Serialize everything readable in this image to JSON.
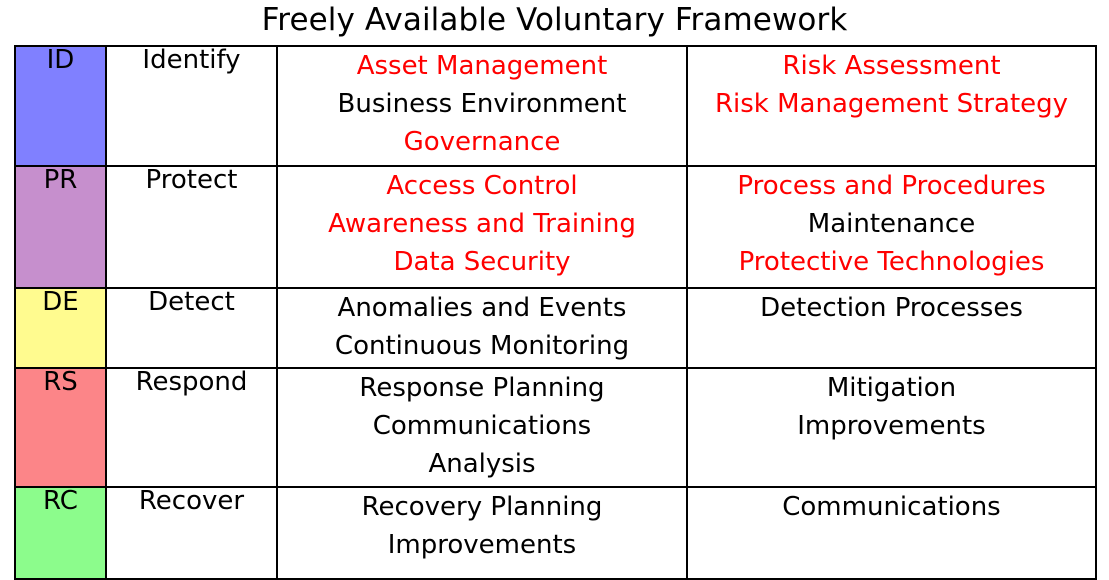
{
  "title": "Freely Available Voluntary Framework",
  "colors": {
    "red_text": "#ff0000",
    "black_text": "#000000",
    "id_swatch": "#8080ff",
    "pr_swatch": "#c68fcd",
    "de_swatch": "#fffb8f",
    "rs_swatch": "#fc8588",
    "rc_swatch": "#8cfc8c",
    "border": "#000000",
    "background": "#ffffff"
  },
  "table": {
    "rows": [
      {
        "code": "ID",
        "function": "Identify",
        "column_a": [
          {
            "text": "Asset Management",
            "color": "red"
          },
          {
            "text": "Business Environment",
            "color": "black"
          },
          {
            "text": "Governance",
            "color": "red"
          }
        ],
        "column_b": [
          {
            "text": "Risk Assessment",
            "color": "red"
          },
          {
            "text": "Risk Management Strategy",
            "color": "red"
          },
          {
            "text": "",
            "color": "blank"
          }
        ]
      },
      {
        "code": "PR",
        "function": "Protect",
        "column_a": [
          {
            "text": "Access Control",
            "color": "red"
          },
          {
            "text": "Awareness and Training",
            "color": "red"
          },
          {
            "text": "Data Security",
            "color": "red"
          }
        ],
        "column_b": [
          {
            "text": "Process and Procedures",
            "color": "red"
          },
          {
            "text": "Maintenance",
            "color": "black"
          },
          {
            "text": "Protective Technologies",
            "color": "red"
          }
        ]
      },
      {
        "code": "DE",
        "function": "Detect",
        "column_a": [
          {
            "text": "Anomalies and Events",
            "color": "black"
          },
          {
            "text": "Continuous Monitoring",
            "color": "black"
          }
        ],
        "column_b": [
          {
            "text": "Detection Processes",
            "color": "black"
          },
          {
            "text": "",
            "color": "blank"
          }
        ]
      },
      {
        "code": "RS",
        "function": "Respond",
        "column_a": [
          {
            "text": "Response Planning",
            "color": "black"
          },
          {
            "text": "Communications",
            "color": "black"
          },
          {
            "text": "Analysis",
            "color": "black"
          }
        ],
        "column_b": [
          {
            "text": "Mitigation",
            "color": "black"
          },
          {
            "text": "Improvements",
            "color": "black"
          },
          {
            "text": "",
            "color": "blank"
          }
        ]
      },
      {
        "code": "RC",
        "function": "Recover",
        "column_a": [
          {
            "text": "Recovery Planning",
            "color": "black"
          },
          {
            "text": "Improvements",
            "color": "black"
          }
        ],
        "column_b": [
          {
            "text": "Communications",
            "color": "black"
          },
          {
            "text": "",
            "color": "blank"
          }
        ]
      }
    ]
  }
}
